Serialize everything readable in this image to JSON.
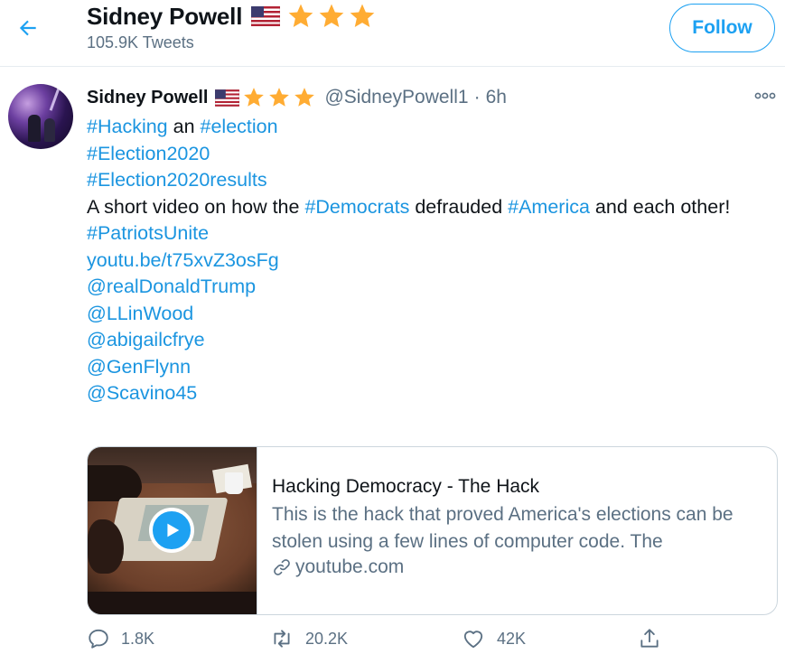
{
  "header": {
    "title": "Sidney Powell",
    "subtitle": "105.9K Tweets",
    "follow_label": "Follow"
  },
  "tweet": {
    "name": "Sidney Powell",
    "handle": "@SidneyPowell1",
    "separator": "·",
    "time": "6h",
    "lines": {
      "l1_tag1": "#Hacking",
      "l1_text": " an ",
      "l1_tag2": "#election",
      "l2": "#Election2020",
      "l3": "#Election2020results",
      "l4_text1": "A short video on how the ",
      "l4_tag1": "#Democrats",
      "l4_text2": " defrauded ",
      "l4_tag2": "#America",
      "l4_text3": " and each other!",
      "l5": "#PatriotsUnite",
      "l6": "youtu.be/t75xvZ3osFg",
      "l7": "@realDonaldTrump",
      "l8": "@LLinWood",
      "l9": "@abigailcfrye",
      "l10": "@GenFlynn",
      "l11": "@Scavino45"
    }
  },
  "card": {
    "title": "Hacking Democracy - The Hack",
    "description": "This is the hack that proved America's elections can be stolen using a few lines of computer code. The",
    "domain": "youtube.com"
  },
  "actions": {
    "replies": "1.8K",
    "retweets": "20.2K",
    "likes": "42K"
  },
  "icons": {
    "back": "back-arrow-icon",
    "star": "star-icon",
    "flag": "us-flag-icon",
    "more": "more-options-icon",
    "play": "play-icon",
    "link": "link-icon",
    "reply": "reply-icon",
    "retweet": "retweet-icon",
    "like": "heart-icon",
    "share": "share-icon"
  },
  "colors": {
    "accent": "#1da1f2",
    "link": "#1b95e0",
    "secondary_text": "#5b7083",
    "star": "#ffac33"
  }
}
